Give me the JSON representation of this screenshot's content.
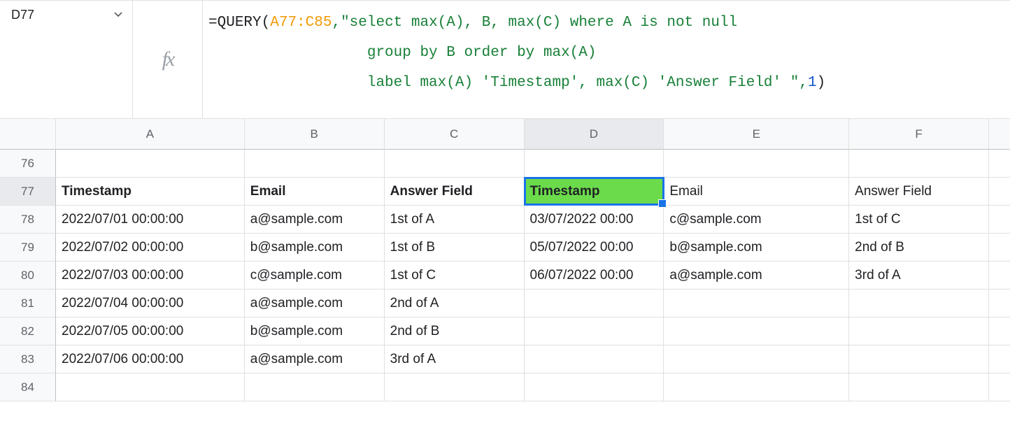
{
  "name_box": {
    "cell_ref": "D77"
  },
  "formula": {
    "raw": "=QUERY(A77:C85,\"select max(A), B, max(C) where A is not null \n                  group by B order by max(A) \n                  label max(A) 'Timestamp', max(C) 'Answer Field' \",1)",
    "fn": "QUERY",
    "range": "A77:C85",
    "string_line1": "\"select max(A), B, max(C) where A is not null ",
    "string_line2": "                  group by B order by max(A) ",
    "string_line3": "                  label max(A) 'Timestamp', max(C) 'Answer Field' \"",
    "arg3": "1"
  },
  "columns": [
    "A",
    "B",
    "C",
    "D",
    "E",
    "F"
  ],
  "selected": {
    "col": "D",
    "row": 77
  },
  "rows": [
    {
      "n": 76,
      "A": "",
      "B": "",
      "C": "",
      "D": "",
      "E": "",
      "F": ""
    },
    {
      "n": 77,
      "A": "Timestamp",
      "B": "Email",
      "C": "Answer Field",
      "D": "Timestamp",
      "E": "Email",
      "F": "Answer Field",
      "bold": true,
      "highlight_D": true
    },
    {
      "n": 78,
      "A": "2022/07/01 00:00:00",
      "B": "a@sample.com",
      "C": "1st of A",
      "D": "03/07/2022 00:00",
      "E": "c@sample.com",
      "F": "1st of C"
    },
    {
      "n": 79,
      "A": "2022/07/02 00:00:00",
      "B": "b@sample.com",
      "C": "1st of B",
      "D": "05/07/2022 00:00",
      "E": "b@sample.com",
      "F": "2nd of B"
    },
    {
      "n": 80,
      "A": "2022/07/03 00:00:00",
      "B": "c@sample.com",
      "C": "1st of C",
      "D": "06/07/2022 00:00",
      "E": "a@sample.com",
      "F": "3rd of A"
    },
    {
      "n": 81,
      "A": "2022/07/04 00:00:00",
      "B": "a@sample.com",
      "C": "2nd of A",
      "D": "",
      "E": "",
      "F": ""
    },
    {
      "n": 82,
      "A": "2022/07/05 00:00:00",
      "B": "b@sample.com",
      "C": "2nd of B",
      "D": "",
      "E": "",
      "F": ""
    },
    {
      "n": 83,
      "A": "2022/07/06 00:00:00",
      "B": "a@sample.com",
      "C": "3rd of A",
      "D": "",
      "E": "",
      "F": ""
    },
    {
      "n": 84,
      "A": "",
      "B": "",
      "C": "",
      "D": "",
      "E": "",
      "F": ""
    }
  ]
}
